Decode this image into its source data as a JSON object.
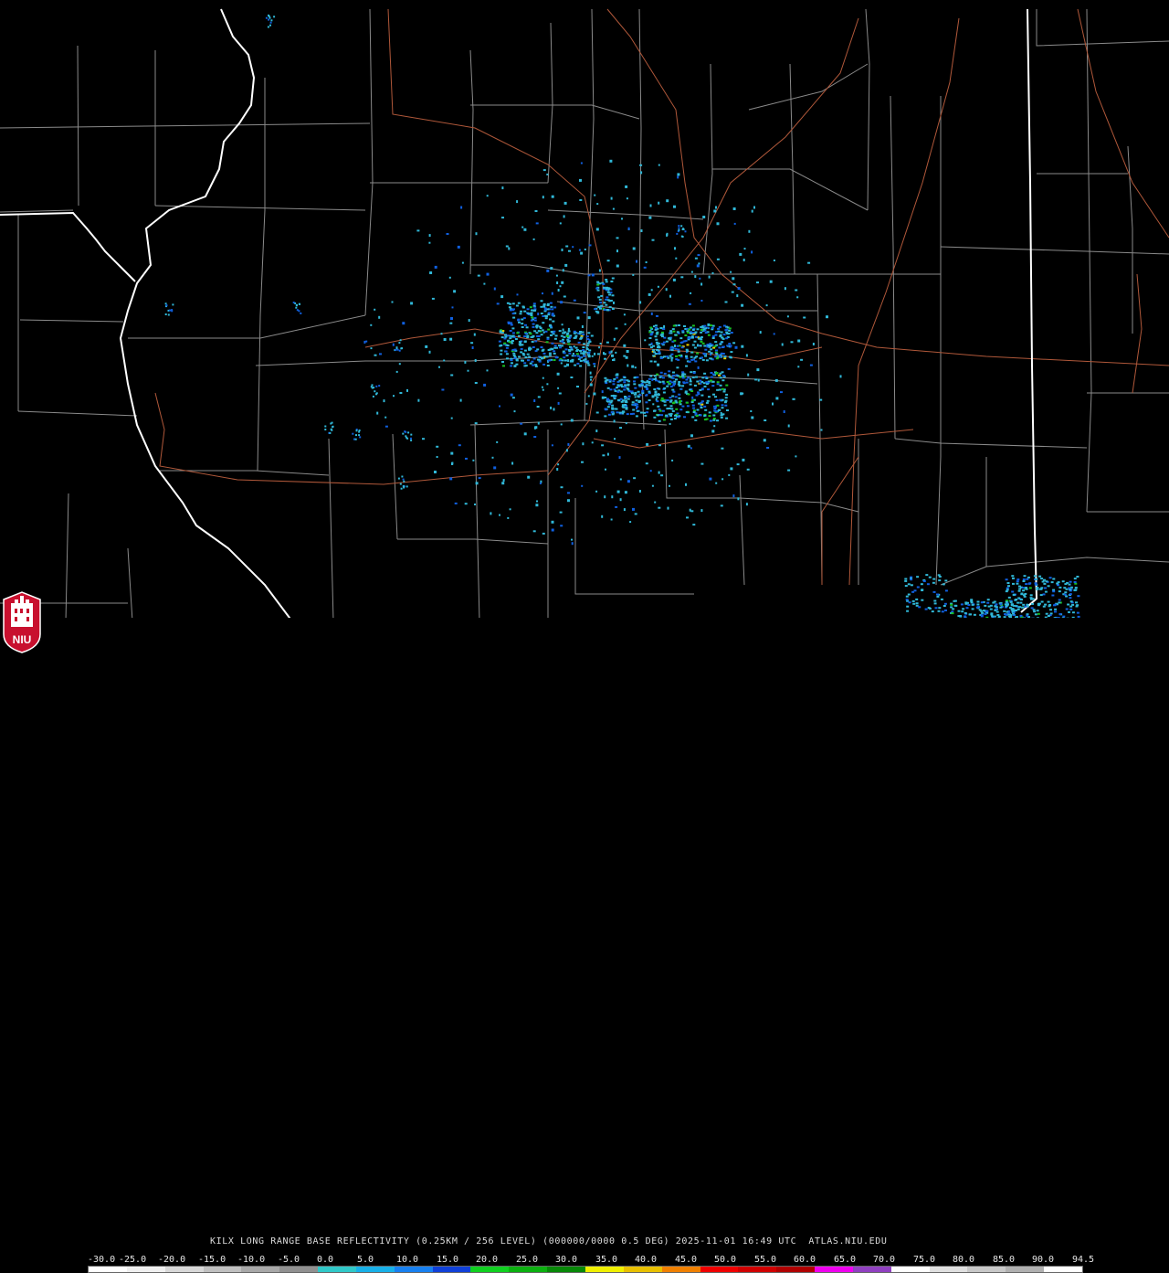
{
  "caption": "KILX LONG RANGE BASE REFLECTIVITY (0.25KM / 256 LEVEL) (000000/0000 0.5 DEG) 2025-11-01 16:49 UTC  ATLAS.NIU.EDU",
  "logo_text": "NIU",
  "scale": {
    "labels": [
      "-30.0",
      "-25.0",
      "-20.0",
      "-15.0",
      "-10.0",
      "-5.0",
      "0.0",
      "5.0",
      "10.0",
      "15.0",
      "20.0",
      "25.0",
      "30.0",
      "35.0",
      "40.0",
      "45.0",
      "50.0",
      "55.0",
      "60.0",
      "65.0",
      "70.0",
      "75.0",
      "80.0",
      "85.0",
      "90.0",
      "94.5"
    ],
    "colors": [
      "#ffffff",
      "#f0f0f0",
      "#d8d8d8",
      "#c0c0c0",
      "#a8a8a8",
      "#909090",
      "#30c8c8",
      "#18b0e8",
      "#1880f0",
      "#1040d8",
      "#10d020",
      "#0cb010",
      "#088808",
      "#f0f000",
      "#e8c000",
      "#f08000",
      "#f00000",
      "#d00000",
      "#b00000",
      "#f000f0",
      "#9040c0",
      "#ffffff",
      "#e0e0e0",
      "#c8c8c8",
      "#b0b0b0",
      "#ffffff"
    ]
  },
  "colors": {
    "background": "#000000",
    "county_lines": "#8a8a8a",
    "state_lines": "#ffffff",
    "roads": "#b0583a",
    "echo_light": "#30b8d8",
    "echo_mid": "#1060e0",
    "echo_green": "#18c020",
    "echo_yellow": "#e8d000"
  }
}
